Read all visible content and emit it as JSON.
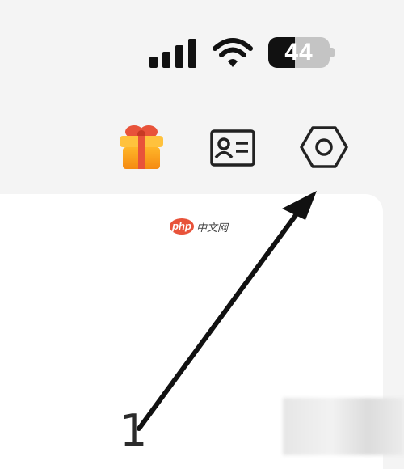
{
  "status_bar": {
    "battery_text": "44",
    "battery_level": 0.44,
    "icons": [
      "signal-icon",
      "wifi-icon",
      "battery-icon"
    ]
  },
  "header": {
    "icons": [
      "gift-icon",
      "id-card-icon",
      "settings-icon"
    ]
  },
  "watermark": {
    "logo_text": "php",
    "site_text": "中文网"
  },
  "annotation": {
    "step_number": "1"
  },
  "colors": {
    "background": "#f4f4f4",
    "card": "#ffffff",
    "gift_orange": "#f5a623",
    "gift_red": "#e8533a",
    "icon_dark": "#222222"
  }
}
